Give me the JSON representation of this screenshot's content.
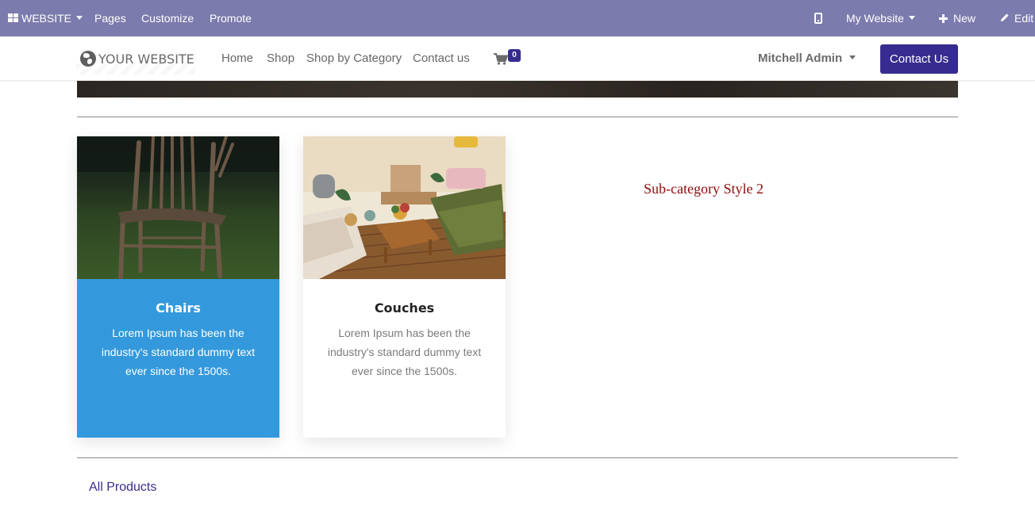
{
  "admin_bar": {
    "website_menu": "WEBSITE",
    "pages": "Pages",
    "customize": "Customize",
    "promote": "Promote",
    "website_switcher": "My Website",
    "new": "New",
    "edit": "Edit",
    "background_color": "#7c7bad"
  },
  "navbar": {
    "logo_text": "YOUR WEBSITE",
    "links": [
      "Home",
      "Shop",
      "Shop by Category",
      "Contact us"
    ],
    "cart_count": "0",
    "user_name": "Mitchell Admin",
    "contact_button": "Contact Us",
    "accent_color": "#362c8f"
  },
  "categories": [
    {
      "title": "Chairs",
      "description": "Lorem Ipsum has been the industry's standard dummy text ever since the 1500s.",
      "state": "selected",
      "background_color": "#3399dc"
    },
    {
      "title": "Couches",
      "description": "Lorem Ipsum has been the industry's standard dummy text ever since the 1500s.",
      "state": "default",
      "background_color": "#ffffff"
    }
  ],
  "subcategory_heading": "Sub-category Style 2",
  "all_products_link": "All Products"
}
